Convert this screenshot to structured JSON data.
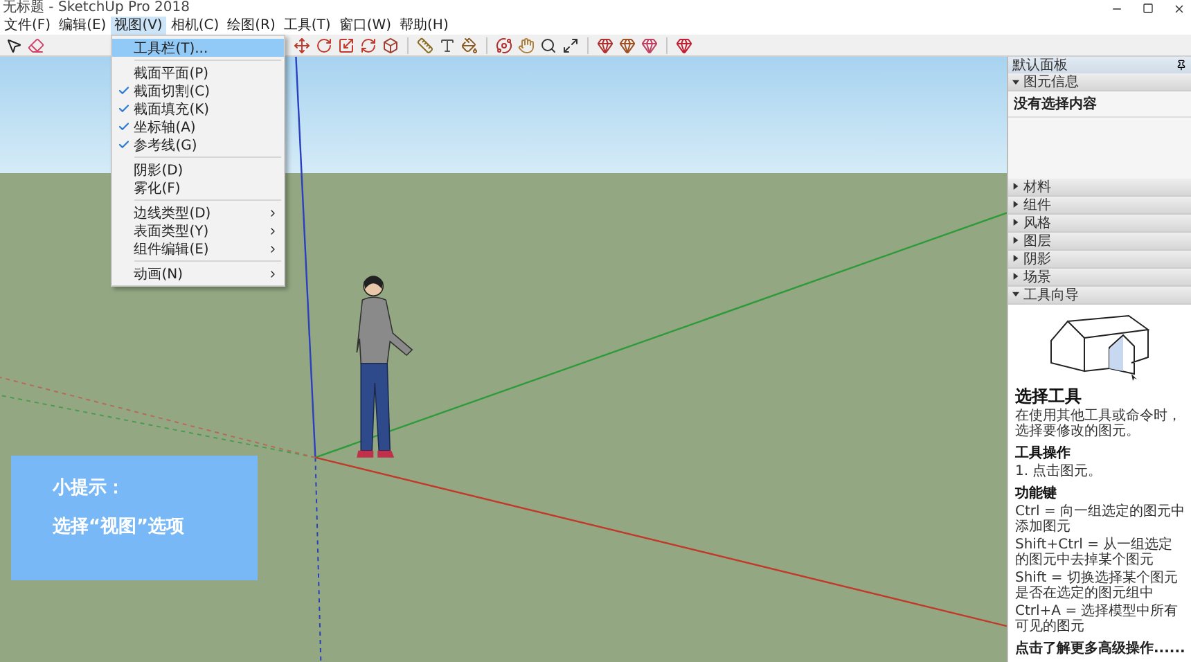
{
  "window": {
    "title": "无标题 - SketchUp Pro 2018"
  },
  "menu_bar": [
    {
      "label": "文件(F)",
      "selected": false
    },
    {
      "label": "编辑(E)",
      "selected": false
    },
    {
      "label": "视图(V)",
      "selected": true
    },
    {
      "label": "相机(C)",
      "selected": false
    },
    {
      "label": "绘图(R)",
      "selected": false
    },
    {
      "label": "工具(T)",
      "selected": false
    },
    {
      "label": "窗口(W)",
      "selected": false
    },
    {
      "label": "帮助(H)",
      "selected": false
    }
  ],
  "view_menu": [
    {
      "kind": "item",
      "label": "工具栏(T)...",
      "checked": false,
      "selected": true,
      "submenu": false
    },
    {
      "kind": "separator"
    },
    {
      "kind": "item",
      "label": "截面平面(P)",
      "checked": false,
      "selected": false,
      "submenu": false
    },
    {
      "kind": "item",
      "label": "截面切割(C)",
      "checked": true,
      "selected": false,
      "submenu": false
    },
    {
      "kind": "item",
      "label": "截面填充(K)",
      "checked": true,
      "selected": false,
      "submenu": false
    },
    {
      "kind": "item",
      "label": "坐标轴(A)",
      "checked": true,
      "selected": false,
      "submenu": false
    },
    {
      "kind": "item",
      "label": "参考线(G)",
      "checked": true,
      "selected": false,
      "submenu": false
    },
    {
      "kind": "separator"
    },
    {
      "kind": "item",
      "label": "阴影(D)",
      "checked": false,
      "selected": false,
      "submenu": false
    },
    {
      "kind": "item",
      "label": "雾化(F)",
      "checked": false,
      "selected": false,
      "submenu": false
    },
    {
      "kind": "separator"
    },
    {
      "kind": "item",
      "label": "边线类型(D)",
      "checked": false,
      "selected": false,
      "submenu": true
    },
    {
      "kind": "item",
      "label": "表面类型(Y)",
      "checked": false,
      "selected": false,
      "submenu": true
    },
    {
      "kind": "item",
      "label": "组件编辑(E)",
      "checked": false,
      "selected": false,
      "submenu": true
    },
    {
      "kind": "separator"
    },
    {
      "kind": "item",
      "label": "动画(N)",
      "checked": false,
      "selected": false,
      "submenu": true
    }
  ],
  "tip": {
    "title": "小提示：",
    "text": "选择“视图”选项"
  },
  "tray": {
    "title": "默认面板",
    "entity_info": {
      "label": "图元信息",
      "expanded": true,
      "content": "没有选择内容"
    },
    "sections": [
      {
        "label": "材料",
        "expanded": false
      },
      {
        "label": "组件",
        "expanded": false
      },
      {
        "label": "风格",
        "expanded": false
      },
      {
        "label": "图层",
        "expanded": false
      },
      {
        "label": "阴影",
        "expanded": false
      },
      {
        "label": "场景",
        "expanded": false
      },
      {
        "label": "工具向导",
        "expanded": true
      }
    ],
    "instructor": {
      "tool_title": "选择工具",
      "description": "在使用其他工具或命令时，选择要修改的图元。",
      "operation_heading": "工具操作",
      "operations": [
        "1. 点击图元。"
      ],
      "keys_heading": "功能键",
      "keys": [
        "Ctrl = 向一组选定的图元中添加图元",
        "Shift+Ctrl = 从一组选定的图元中去掉某个图元",
        "Shift = 切换选择某个图元是否在选定的图元组中",
        "Ctrl+A = 选择模型中所有可见的图元"
      ],
      "link": "点击了解更多高级操作......"
    }
  }
}
